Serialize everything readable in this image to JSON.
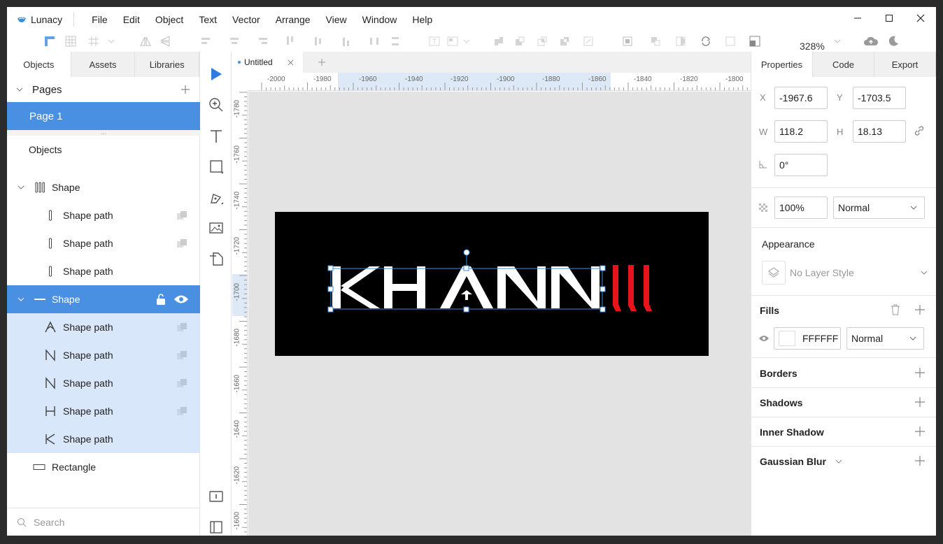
{
  "app": {
    "name": "Lunacy"
  },
  "menu": [
    "File",
    "Edit",
    "Object",
    "Text",
    "Vector",
    "Arrange",
    "View",
    "Window",
    "Help"
  ],
  "toolbar": {
    "zoom": "328%"
  },
  "left_panel": {
    "tabs": [
      "Objects",
      "Assets",
      "Libraries"
    ],
    "pages_label": "Pages",
    "pages": [
      "Page 1"
    ],
    "grip": "...",
    "objects_label": "Objects",
    "layers": [
      {
        "label": "Shape",
        "type": "group-vertical"
      },
      {
        "label": "Shape path",
        "type": "path-line"
      },
      {
        "label": "Shape path",
        "type": "path-line"
      },
      {
        "label": "Shape path",
        "type": "path-line"
      },
      {
        "label": "Shape",
        "type": "group-horizontal"
      },
      {
        "label": "Shape path",
        "type": "path-A"
      },
      {
        "label": "Shape path",
        "type": "path-N"
      },
      {
        "label": "Shape path",
        "type": "path-N"
      },
      {
        "label": "Shape path",
        "type": "path-H"
      },
      {
        "label": "Shape path",
        "type": "path-K"
      },
      {
        "label": "Rectangle",
        "type": "rectangle"
      }
    ],
    "search_placeholder": "Search"
  },
  "document": {
    "tab_title": "Untitled"
  },
  "rulers": {
    "top": [
      "-2000",
      "-1980",
      "-1960",
      "-1940",
      "-1920",
      "-1900",
      "-1880",
      "-1860",
      "-1840",
      "-1820",
      "-1800"
    ],
    "left": [
      "-1780",
      "-1760",
      "-1740",
      "-1720",
      "-1700",
      "-1680",
      "-1660",
      "-1640",
      "-1620",
      "-1600"
    ]
  },
  "artwork": {
    "text": "KHANN",
    "text_color": "#FFFFFF",
    "accent_color": "#E8141B",
    "background": "#000000"
  },
  "right_panel": {
    "tabs": [
      "Properties",
      "Code",
      "Export"
    ],
    "x_label": "X",
    "x_value": "-1967.6",
    "y_label": "Y",
    "y_value": "-1703.5",
    "w_label": "W",
    "w_value": "118.2",
    "h_label": "H",
    "h_value": "18.13",
    "rotation_value": "0°",
    "opacity_value": "100%",
    "blend_mode": "Normal",
    "appearance_title": "Appearance",
    "layer_style": "No Layer Style",
    "fills_title": "Fills",
    "fill_hex": "FFFFFF",
    "fill_blend": "Normal",
    "borders_title": "Borders",
    "shadows_title": "Shadows",
    "inner_shadow_title": "Inner Shadow",
    "gaussian_blur_title": "Gaussian Blur"
  },
  "colors": {
    "accent": "#4A90E2",
    "selection_light": "#D8E7F9"
  }
}
